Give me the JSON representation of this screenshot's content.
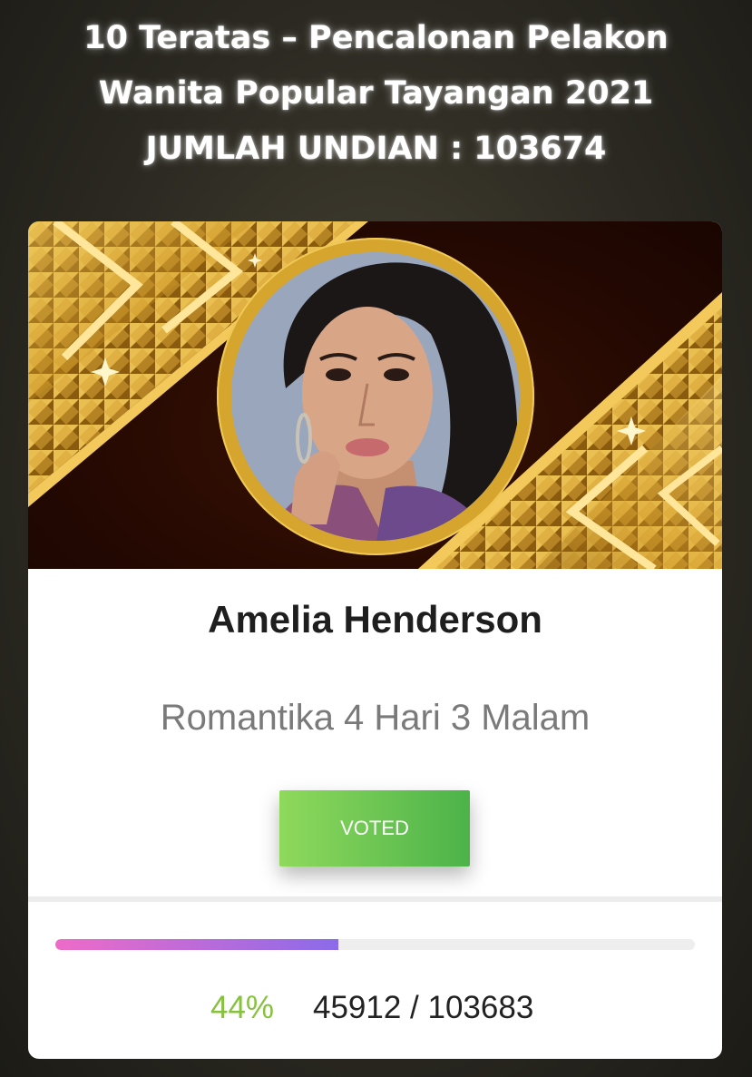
{
  "header": {
    "line1": "10 Teratas – Pencalonan Pelakon",
    "line2": "Wanita Popular Tayangan 2021",
    "line3": "JUMLAH UNDIAN : 103674"
  },
  "nominee": {
    "name": "Amelia Henderson",
    "show": "Romantika 4 Hari 3 Malam"
  },
  "vote_button": {
    "label": "VOTED"
  },
  "result": {
    "percent_label": "44%",
    "votes_label": "45912 / 103683",
    "progress_fraction": 0.442
  },
  "colors": {
    "accent_green": "#86c23e",
    "button_green": "#4cb34a",
    "progress_pink": "#ee6bc8",
    "progress_purple": "#8b6bea",
    "frame_gold": "#d5a52e"
  }
}
